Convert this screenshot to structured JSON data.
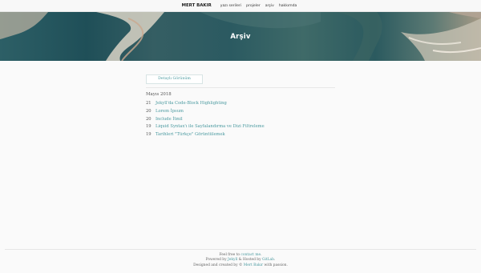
{
  "nav": {
    "brand": "MERT BAKIR",
    "links": [
      "yazı serileri",
      "projeler",
      "arşiv",
      "hakkımda"
    ]
  },
  "hero": {
    "title": "Arşiv"
  },
  "archive": {
    "toggle_label": "Detaylı Görünüm",
    "month": "Mayıs 2018",
    "posts": [
      {
        "day": "21",
        "title": "Jekyll'da Code-Block Highlighting"
      },
      {
        "day": "20",
        "title": "Lorem İpsum"
      },
      {
        "day": "20",
        "title": "Include İtmil"
      },
      {
        "day": "19",
        "title": "Liquid Syntax'ı ile Sayfalandırma ve Dizi Filtreleme"
      },
      {
        "day": "19",
        "title": "Tarihleri \"Türkçe\" Görüntülemek"
      }
    ]
  },
  "footer": {
    "line1_prefix": "Feel free to ",
    "line1_link": "contact me",
    "line1_suffix": ".",
    "line2_prefix": "Powered by ",
    "line2_link1": "Jekyll",
    "line2_mid": " & Hosted by ",
    "line2_link2": "GitLab",
    "line2_suffix": ".",
    "line3_prefix": "Designed and created by © ",
    "line3_link": "Mert Bakır",
    "line3_suffix": " with passion."
  }
}
